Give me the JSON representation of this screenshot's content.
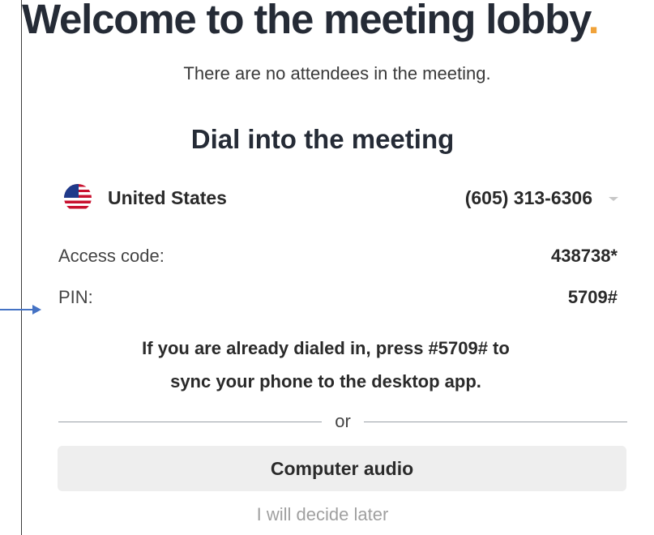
{
  "lobby": {
    "title": "Welcome to the meeting lobby",
    "title_dot": ".",
    "subtitle": "There are no attendees in the meeting.",
    "dial_heading": "Dial into the meeting",
    "country": {
      "flag_icon": "us-flag-icon",
      "name": "United States",
      "phone": "(605) 313-6306"
    },
    "access_code": {
      "label": "Access code:",
      "value": "438738*"
    },
    "pin": {
      "label": "PIN:",
      "value": "5709#"
    },
    "sync_message": {
      "line1": "If you are already dialed in, press #5709# to",
      "line2": "sync your phone to the desktop app."
    },
    "divider_text": "or",
    "computer_audio_label": "Computer audio",
    "decide_later_label": "I will decide later"
  },
  "colors": {
    "title": "#252b36",
    "accent_dot": "#f0a23a",
    "button_bg": "#eeeeee",
    "annotation_arrow": "#4472c4"
  }
}
